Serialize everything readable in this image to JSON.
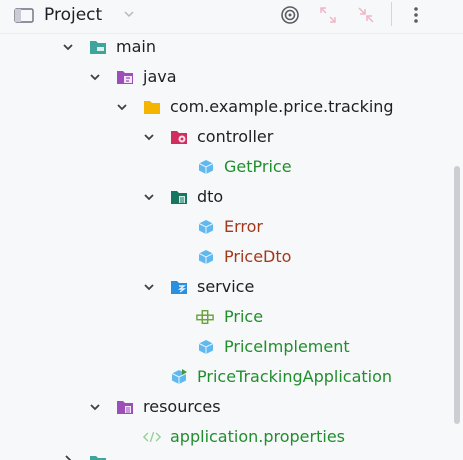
{
  "toolbar": {
    "title": "Project",
    "folder_icon": "project-folder-icon",
    "chevron_icon": "chevron-down-icon",
    "locate_icon": "target-icon",
    "expand_icon": "expand-all-icon",
    "collapse_icon": "collapse-all-icon",
    "more_icon": "kebab-menu-icon"
  },
  "tree": [
    {
      "label": "main",
      "icon": "module-folder-icon",
      "color": "dark"
    },
    {
      "label": "java",
      "icon": "java-source-folder-icon",
      "color": "dark"
    },
    {
      "label": "com.example.price.tracking",
      "icon": "package-folder-icon",
      "color": "dark"
    },
    {
      "label": "controller",
      "icon": "controller-folder-icon",
      "color": "dark"
    },
    {
      "label": "GetPrice",
      "icon": "class-icon",
      "color": "green"
    },
    {
      "label": "dto",
      "icon": "dto-folder-icon",
      "color": "dark"
    },
    {
      "label": "Error",
      "icon": "class-icon",
      "color": "red"
    },
    {
      "label": "PriceDto",
      "icon": "class-icon",
      "color": "red"
    },
    {
      "label": "service",
      "icon": "service-folder-icon",
      "color": "dark"
    },
    {
      "label": "Price",
      "icon": "interface-icon",
      "color": "green"
    },
    {
      "label": "PriceImplement",
      "icon": "class-icon",
      "color": "green"
    },
    {
      "label": "PriceTrackingApplication",
      "icon": "spring-application-icon",
      "color": "green"
    },
    {
      "label": "resources",
      "icon": "resources-folder-icon",
      "color": "dark"
    },
    {
      "label": "application.properties",
      "icon": "properties-file-icon",
      "color": "green"
    }
  ]
}
